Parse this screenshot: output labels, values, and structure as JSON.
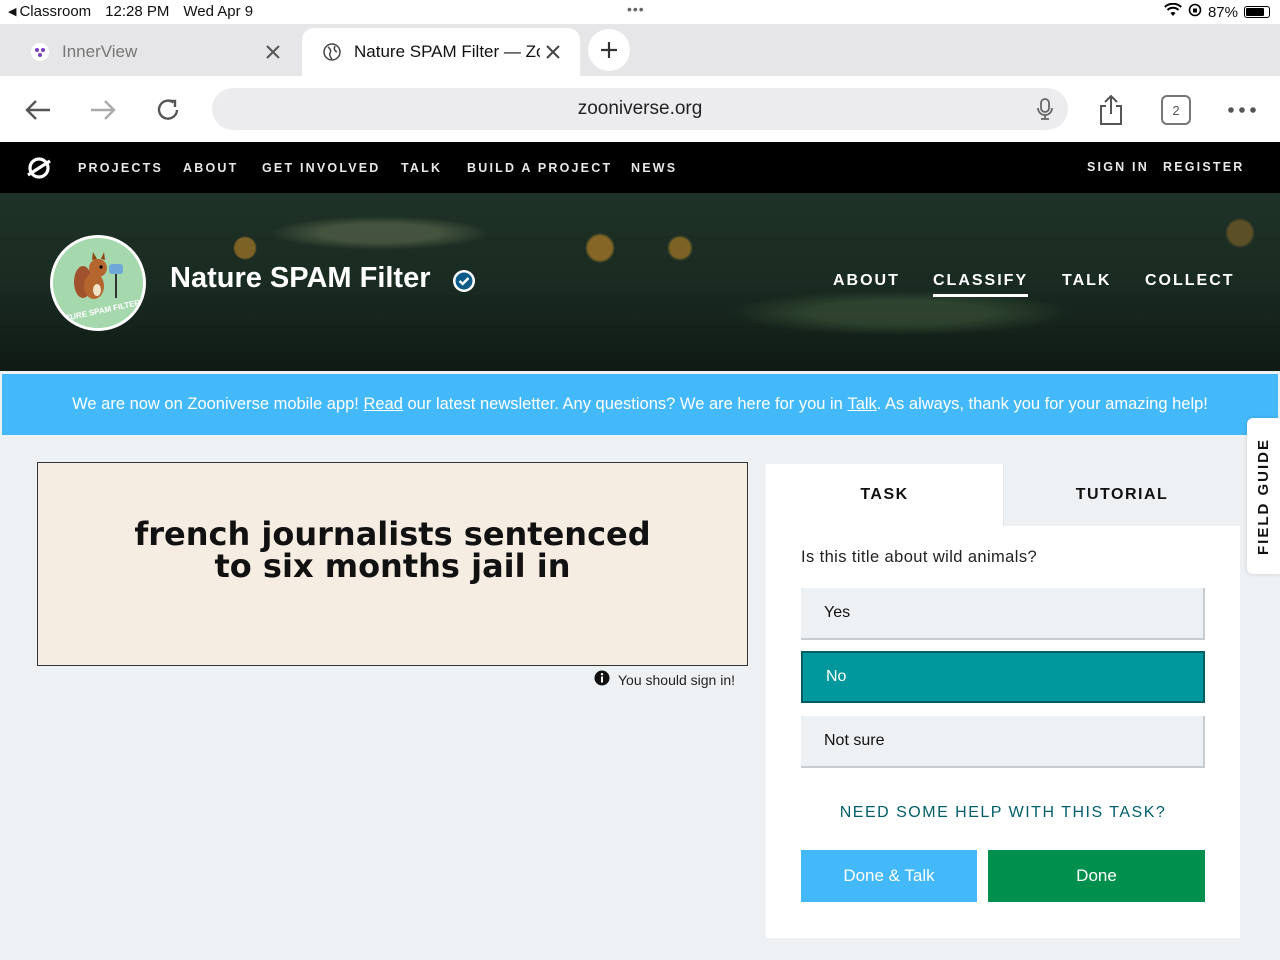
{
  "status_bar": {
    "back_app": "Classroom",
    "time": "12:28 PM",
    "date": "Wed Apr 9",
    "battery": "87%"
  },
  "browser": {
    "tabs": [
      {
        "title": "InnerView",
        "active": false
      },
      {
        "title": "Nature SPAM Filter — Zooniverse",
        "active": true
      }
    ],
    "url": "zooniverse.org",
    "tab_count": "2"
  },
  "zooniverse_nav": {
    "items": [
      "PROJECTS",
      "ABOUT",
      "GET INVOLVED",
      "TALK",
      "BUILD A PROJECT",
      "NEWS"
    ],
    "sign_in": "SIGN IN",
    "register": "REGISTER"
  },
  "project": {
    "title": "Nature SPAM Filter",
    "avatar_text": "NATURE SPAM FILTER",
    "nav": [
      "ABOUT",
      "CLASSIFY",
      "TALK",
      "COLLECT"
    ],
    "active_nav": "CLASSIFY"
  },
  "banner": {
    "part1": "We are now on Zooniverse mobile app! ",
    "read_link": "Read",
    "part2": " our latest newsletter. Any questions? We are here for you in ",
    "talk_link": "Talk",
    "part3": ". As always, thank you for your amazing help!"
  },
  "subject": {
    "text": "french journalists sentenced to six months jail in",
    "sign_in_note": "You should sign in!"
  },
  "task_panel": {
    "tabs": [
      "TASK",
      "TUTORIAL"
    ],
    "question": "Is this title about wild animals?",
    "answers": [
      "Yes",
      "No",
      "Not sure"
    ],
    "selected_answer": "No",
    "help_link": "NEED SOME HELP WITH THIS TASK?",
    "done_talk_label": "Done & Talk",
    "done_label": "Done"
  },
  "field_guide_label": "FIELD GUIDE",
  "colors": {
    "banner": "#43b9fa",
    "selected_answer": "#00979d",
    "done_button": "#008f4c",
    "done_talk_button": "#43b9fa"
  }
}
